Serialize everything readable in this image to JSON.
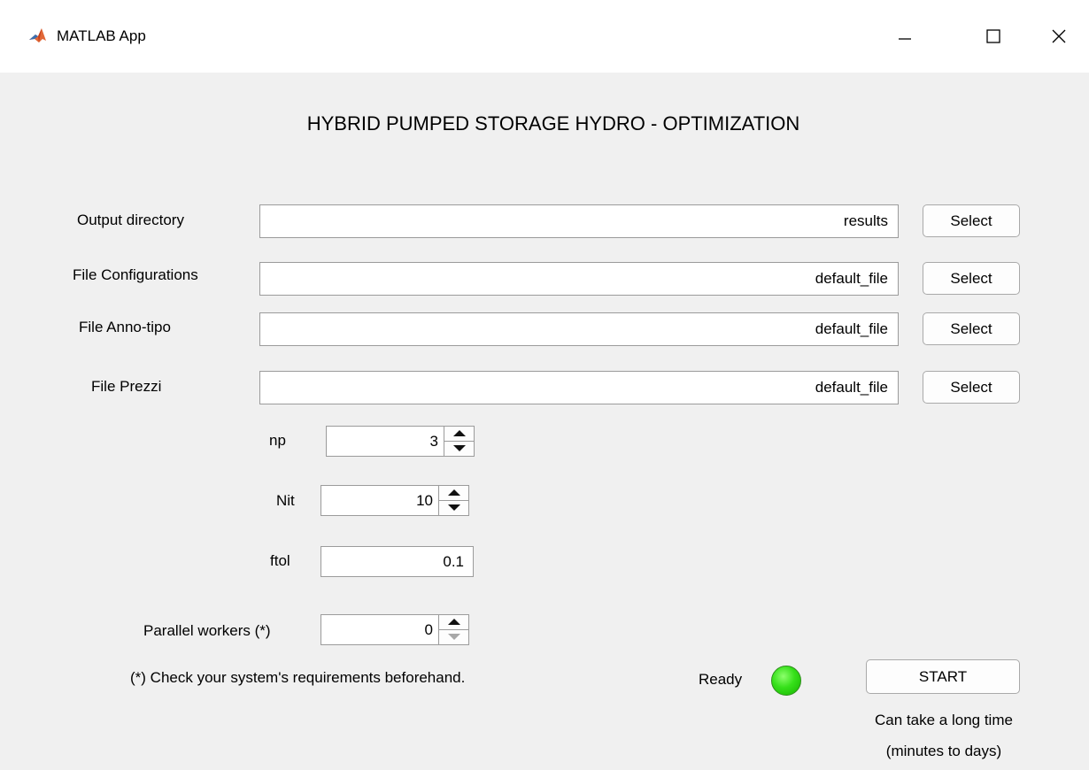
{
  "window": {
    "title": "MATLAB App",
    "icon": "matlab-logo-icon",
    "controls": {
      "minimize_icon": "minimize-icon",
      "maximize_icon": "maximize-icon",
      "close_icon": "close-icon"
    }
  },
  "heading": "HYBRID PUMPED STORAGE HYDRO - OPTIMIZATION",
  "files": {
    "output_dir": {
      "label": "Output directory",
      "value": "results",
      "button": "Select"
    },
    "configurations": {
      "label": "File Configurations",
      "value": "default_file",
      "button": "Select"
    },
    "anno_tipo": {
      "label": "File Anno-tipo",
      "value": "default_file",
      "button": "Select"
    },
    "prezzi": {
      "label": "File Prezzi",
      "value": "default_file",
      "button": "Select"
    }
  },
  "params": {
    "np": {
      "label": "np",
      "value": "3"
    },
    "nit": {
      "label": "Nit",
      "value": "10"
    },
    "ftol": {
      "label": "ftol",
      "value": "0.1"
    },
    "workers": {
      "label": "Parallel workers (*)",
      "value": "0"
    }
  },
  "note": "(*) Check your system's requirements beforehand.",
  "status": {
    "label": "Ready",
    "lamp_color": "#33dd1a"
  },
  "start": {
    "label": "START",
    "hint_line1": "Can take a long time",
    "hint_line2": "(minutes to days)"
  }
}
